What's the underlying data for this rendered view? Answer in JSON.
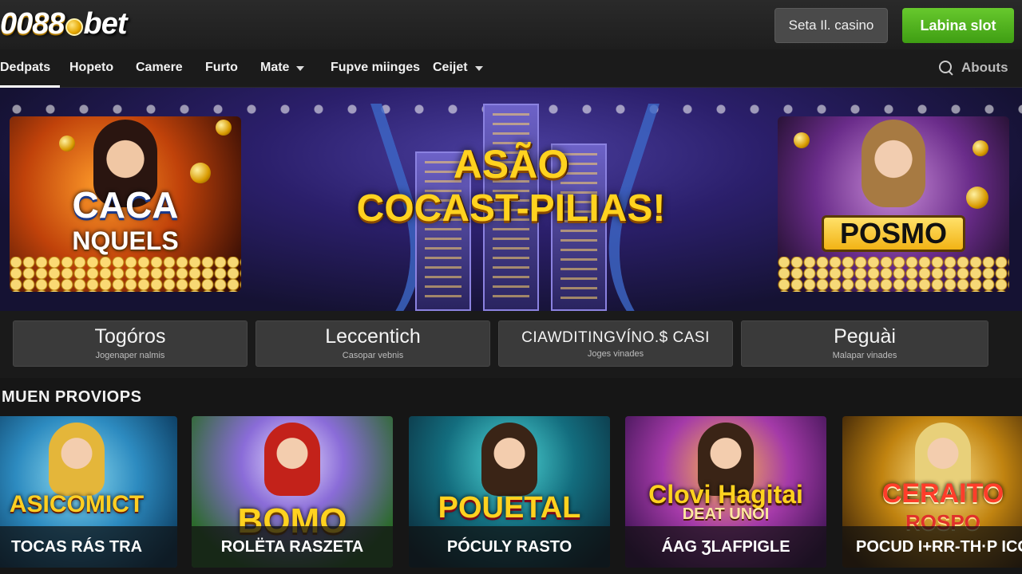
{
  "header": {
    "logo_num": "0088",
    "logo_bet": "bet",
    "casino_button": "Seta Il. casino",
    "slot_button": "Labina slot"
  },
  "nav": {
    "items": [
      {
        "label": "Dedpats",
        "active": true
      },
      {
        "label": "Hopeto"
      },
      {
        "label": "Camere"
      },
      {
        "label": "Furto"
      },
      {
        "label": "Mate",
        "dropdown": true
      },
      {
        "label": "Fupve miinges"
      },
      {
        "label": "Ceijet",
        "dropdown": true
      }
    ],
    "search_label": "Abouts"
  },
  "hero": {
    "title_line1": "ASÃO",
    "title_line2": "COCAST-PILIAS!",
    "promo_left_line1": "CACA",
    "promo_left_line2": "NQUELS",
    "promo_right": "POSMO"
  },
  "categories": [
    {
      "title": "Togóros",
      "sub": "Jogenaper nalmis"
    },
    {
      "title": "Leccentich",
      "sub": "Casopar vebnis"
    },
    {
      "title": "CIAWDITINGVÍNO.$ CASI",
      "sub": "Joges vinades"
    },
    {
      "title": "Peguài",
      "sub": "Malapar vinades"
    }
  ],
  "section": {
    "title": "MUEN PROVIOPS"
  },
  "games": [
    {
      "art": "ASICOMICT",
      "art2": "",
      "label": "TOCAS RÁS TRA"
    },
    {
      "art": "BOMO",
      "art2": "",
      "label": "ROLËTA RASZETA"
    },
    {
      "art": "POUETAL",
      "art2": "",
      "label": "PÓCULY RASTO"
    },
    {
      "art": "Clovi Hagitai",
      "art2": "DEAT UNOI",
      "label": "ÁAG ƷLAFPIGLE"
    },
    {
      "art": "CERAITO",
      "art2": "ROSPO",
      "label": "POCUD I+RR-TH·P ICO"
    }
  ],
  "colors": {
    "accent_green": "#4caf1e",
    "gold": "#ffd21f",
    "background": "#161616"
  }
}
